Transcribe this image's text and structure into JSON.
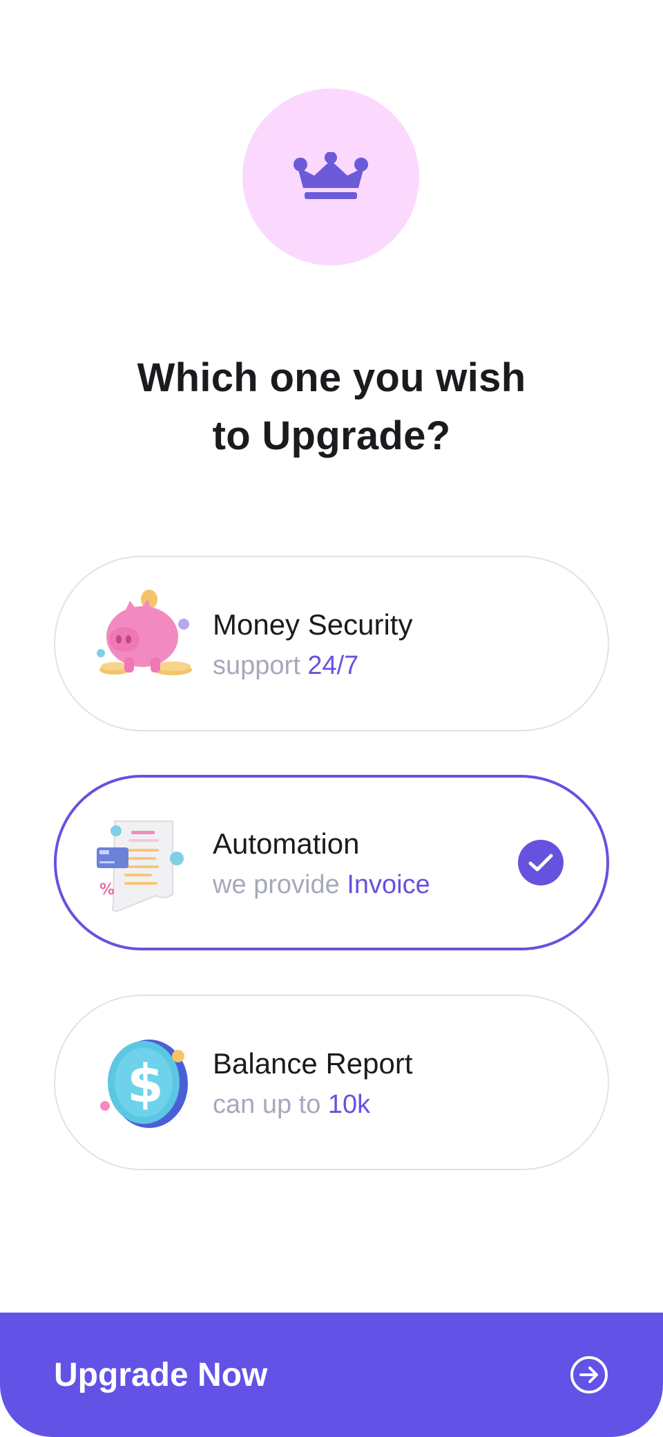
{
  "header": {
    "icon": "crown-icon",
    "title_line1": "Which one you wish",
    "title_line2": "to Upgrade?"
  },
  "options": [
    {
      "title": "Money Security",
      "sub_prefix": "support",
      "sub_highlight": "24/7",
      "illustration": "piggy-bank-illustration",
      "selected": false
    },
    {
      "title": "Automation",
      "sub_prefix": "we provide",
      "sub_highlight": "Invoice",
      "illustration": "invoice-illustration",
      "selected": true
    },
    {
      "title": "Balance Report",
      "sub_prefix": "can up to",
      "sub_highlight": "10k",
      "illustration": "dollar-coin-illustration",
      "selected": false
    }
  ],
  "cta": {
    "label": "Upgrade Now",
    "icon": "arrow-right-circle-icon"
  },
  "colors": {
    "accent": "#6352e6",
    "crown_bg": "#fbd9ff",
    "muted_text": "#a6a8bb",
    "card_border": "#dfe1ee"
  }
}
